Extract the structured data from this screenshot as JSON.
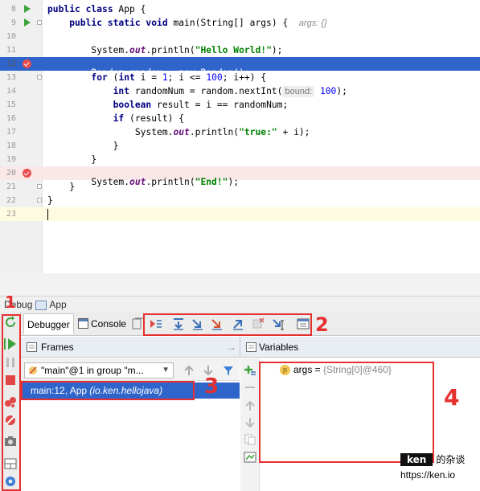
{
  "editor": {
    "lines": [
      {
        "num": "8",
        "segments": [
          {
            "t": "public class ",
            "c": "kw"
          },
          {
            "t": "App {",
            "c": ""
          }
        ]
      },
      {
        "num": "9",
        "segments": [
          {
            "t": "    public static void ",
            "c": "kw"
          },
          {
            "t": "main(String[] args) {  ",
            "c": ""
          },
          {
            "t": "args: {}",
            "c": "hint"
          }
        ]
      },
      {
        "num": "10",
        "segments": []
      },
      {
        "num": "11",
        "segments": [
          {
            "t": "        System.",
            "c": ""
          },
          {
            "t": "out",
            "c": "fld"
          },
          {
            "t": ".println(",
            "c": ""
          },
          {
            "t": "\"Hello World!\"",
            "c": "str"
          },
          {
            "t": ");",
            "c": ""
          }
        ]
      },
      {
        "num": "12",
        "segments": [
          {
            "t": "        Random random = ",
            "c": ""
          },
          {
            "t": "new ",
            "c": "kw"
          },
          {
            "t": "Random();",
            "c": ""
          }
        ]
      },
      {
        "num": "13",
        "segments": [
          {
            "t": "        ",
            "c": ""
          },
          {
            "t": "for ",
            "c": "kw"
          },
          {
            "t": "(",
            "c": ""
          },
          {
            "t": "int ",
            "c": "kw"
          },
          {
            "t": "i = ",
            "c": ""
          },
          {
            "t": "1",
            "c": "num"
          },
          {
            "t": "; i <= ",
            "c": ""
          },
          {
            "t": "100",
            "c": "num"
          },
          {
            "t": "; i++) {",
            "c": ""
          }
        ]
      },
      {
        "num": "14",
        "segments": [
          {
            "t": "            ",
            "c": ""
          },
          {
            "t": "int ",
            "c": "kw"
          },
          {
            "t": "randomNum = random.nextInt(",
            "c": ""
          },
          {
            "t": "bound:",
            "c": "phint"
          },
          {
            "t": " ",
            "c": ""
          },
          {
            "t": "100",
            "c": "num"
          },
          {
            "t": ");",
            "c": ""
          }
        ]
      },
      {
        "num": "15",
        "segments": [
          {
            "t": "            ",
            "c": ""
          },
          {
            "t": "boolean ",
            "c": "kw"
          },
          {
            "t": "result = i == randomNum;",
            "c": ""
          }
        ]
      },
      {
        "num": "16",
        "segments": [
          {
            "t": "            ",
            "c": ""
          },
          {
            "t": "if ",
            "c": "kw"
          },
          {
            "t": "(result) {",
            "c": ""
          }
        ]
      },
      {
        "num": "17",
        "segments": [
          {
            "t": "                System.",
            "c": ""
          },
          {
            "t": "out",
            "c": "fld"
          },
          {
            "t": ".println(",
            "c": ""
          },
          {
            "t": "\"true:\"",
            "c": "str"
          },
          {
            "t": " + i);",
            "c": ""
          }
        ]
      },
      {
        "num": "18",
        "segments": [
          {
            "t": "            }",
            "c": ""
          }
        ]
      },
      {
        "num": "19",
        "segments": [
          {
            "t": "        }",
            "c": ""
          }
        ]
      },
      {
        "num": "20",
        "segments": [
          {
            "t": "        System.",
            "c": ""
          },
          {
            "t": "out",
            "c": "fld"
          },
          {
            "t": ".println(",
            "c": ""
          },
          {
            "t": "\"End!\"",
            "c": "str"
          },
          {
            "t": ");",
            "c": ""
          }
        ]
      },
      {
        "num": "21",
        "segments": [
          {
            "t": "    }",
            "c": ""
          }
        ]
      },
      {
        "num": "22",
        "segments": [
          {
            "t": "}",
            "c": ""
          }
        ]
      },
      {
        "num": "23",
        "segments": []
      }
    ]
  },
  "debug": {
    "title": "Debug",
    "config": "App",
    "tabs": {
      "debugger": "Debugger",
      "console": "Console"
    },
    "frames_title": "Frames",
    "variables_title": "Variables",
    "thread": "\"main\"@1 in group \"m...",
    "frame": {
      "location": "main:12, App ",
      "package": "(io.ken.hellojava)"
    },
    "variable": {
      "name": "args",
      "eq": " = ",
      "value": "{String[0]@460}"
    }
  },
  "annotations": {
    "n1": "1",
    "n2": "2",
    "n3": "3",
    "n4": "4"
  },
  "watermark": {
    "badge": "ken",
    "text": "的杂谈",
    "url": "https://ken.io"
  },
  "colors": {
    "selection": "#2f65ca",
    "breakpoint_line": "#fae8e8",
    "annotation": "#e53030"
  }
}
